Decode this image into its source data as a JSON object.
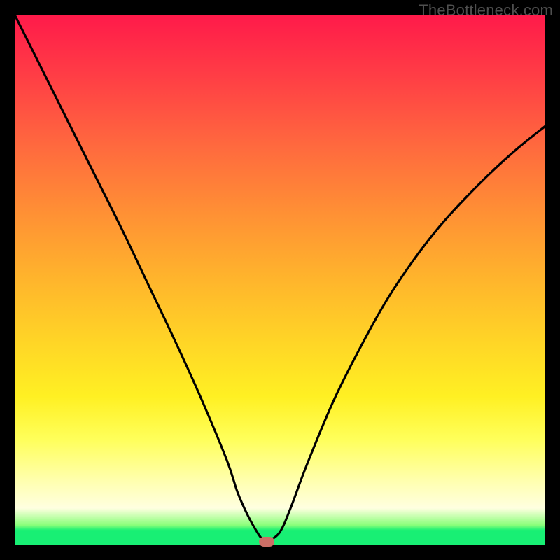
{
  "watermark": "TheBottleneck.com",
  "colors": {
    "frame_border": "#000000",
    "curve": "#000000",
    "dot": "#cc6e66",
    "gradient_top": "#ff1a4a",
    "gradient_bottom": "#18ef74"
  },
  "chart_data": {
    "type": "line",
    "title": "",
    "xlabel": "",
    "ylabel": "",
    "xlim": [
      0,
      100
    ],
    "ylim": [
      0,
      100
    ],
    "grid": false,
    "legend": null,
    "series": [
      {
        "name": "left-branch",
        "x": [
          0,
          5,
          10,
          15,
          20,
          25,
          30,
          35,
          40,
          42,
          44,
          46,
          47
        ],
        "values": [
          100,
          90,
          80,
          70,
          60,
          49.5,
          39,
          28,
          16,
          10,
          5.5,
          2,
          0.8
        ]
      },
      {
        "name": "right-branch",
        "x": [
          48,
          50,
          52,
          55,
          60,
          65,
          70,
          75,
          80,
          85,
          90,
          95,
          100
        ],
        "values": [
          0.8,
          2.5,
          7,
          15,
          27,
          37,
          46,
          53.5,
          60,
          65.5,
          70.5,
          75,
          79
        ]
      }
    ],
    "flat_bottom_segment": {
      "x_start": 46.5,
      "x_end": 48.5,
      "y": 0.7
    },
    "marker": {
      "x": 47.5,
      "y": 0.7
    },
    "annotations": []
  }
}
